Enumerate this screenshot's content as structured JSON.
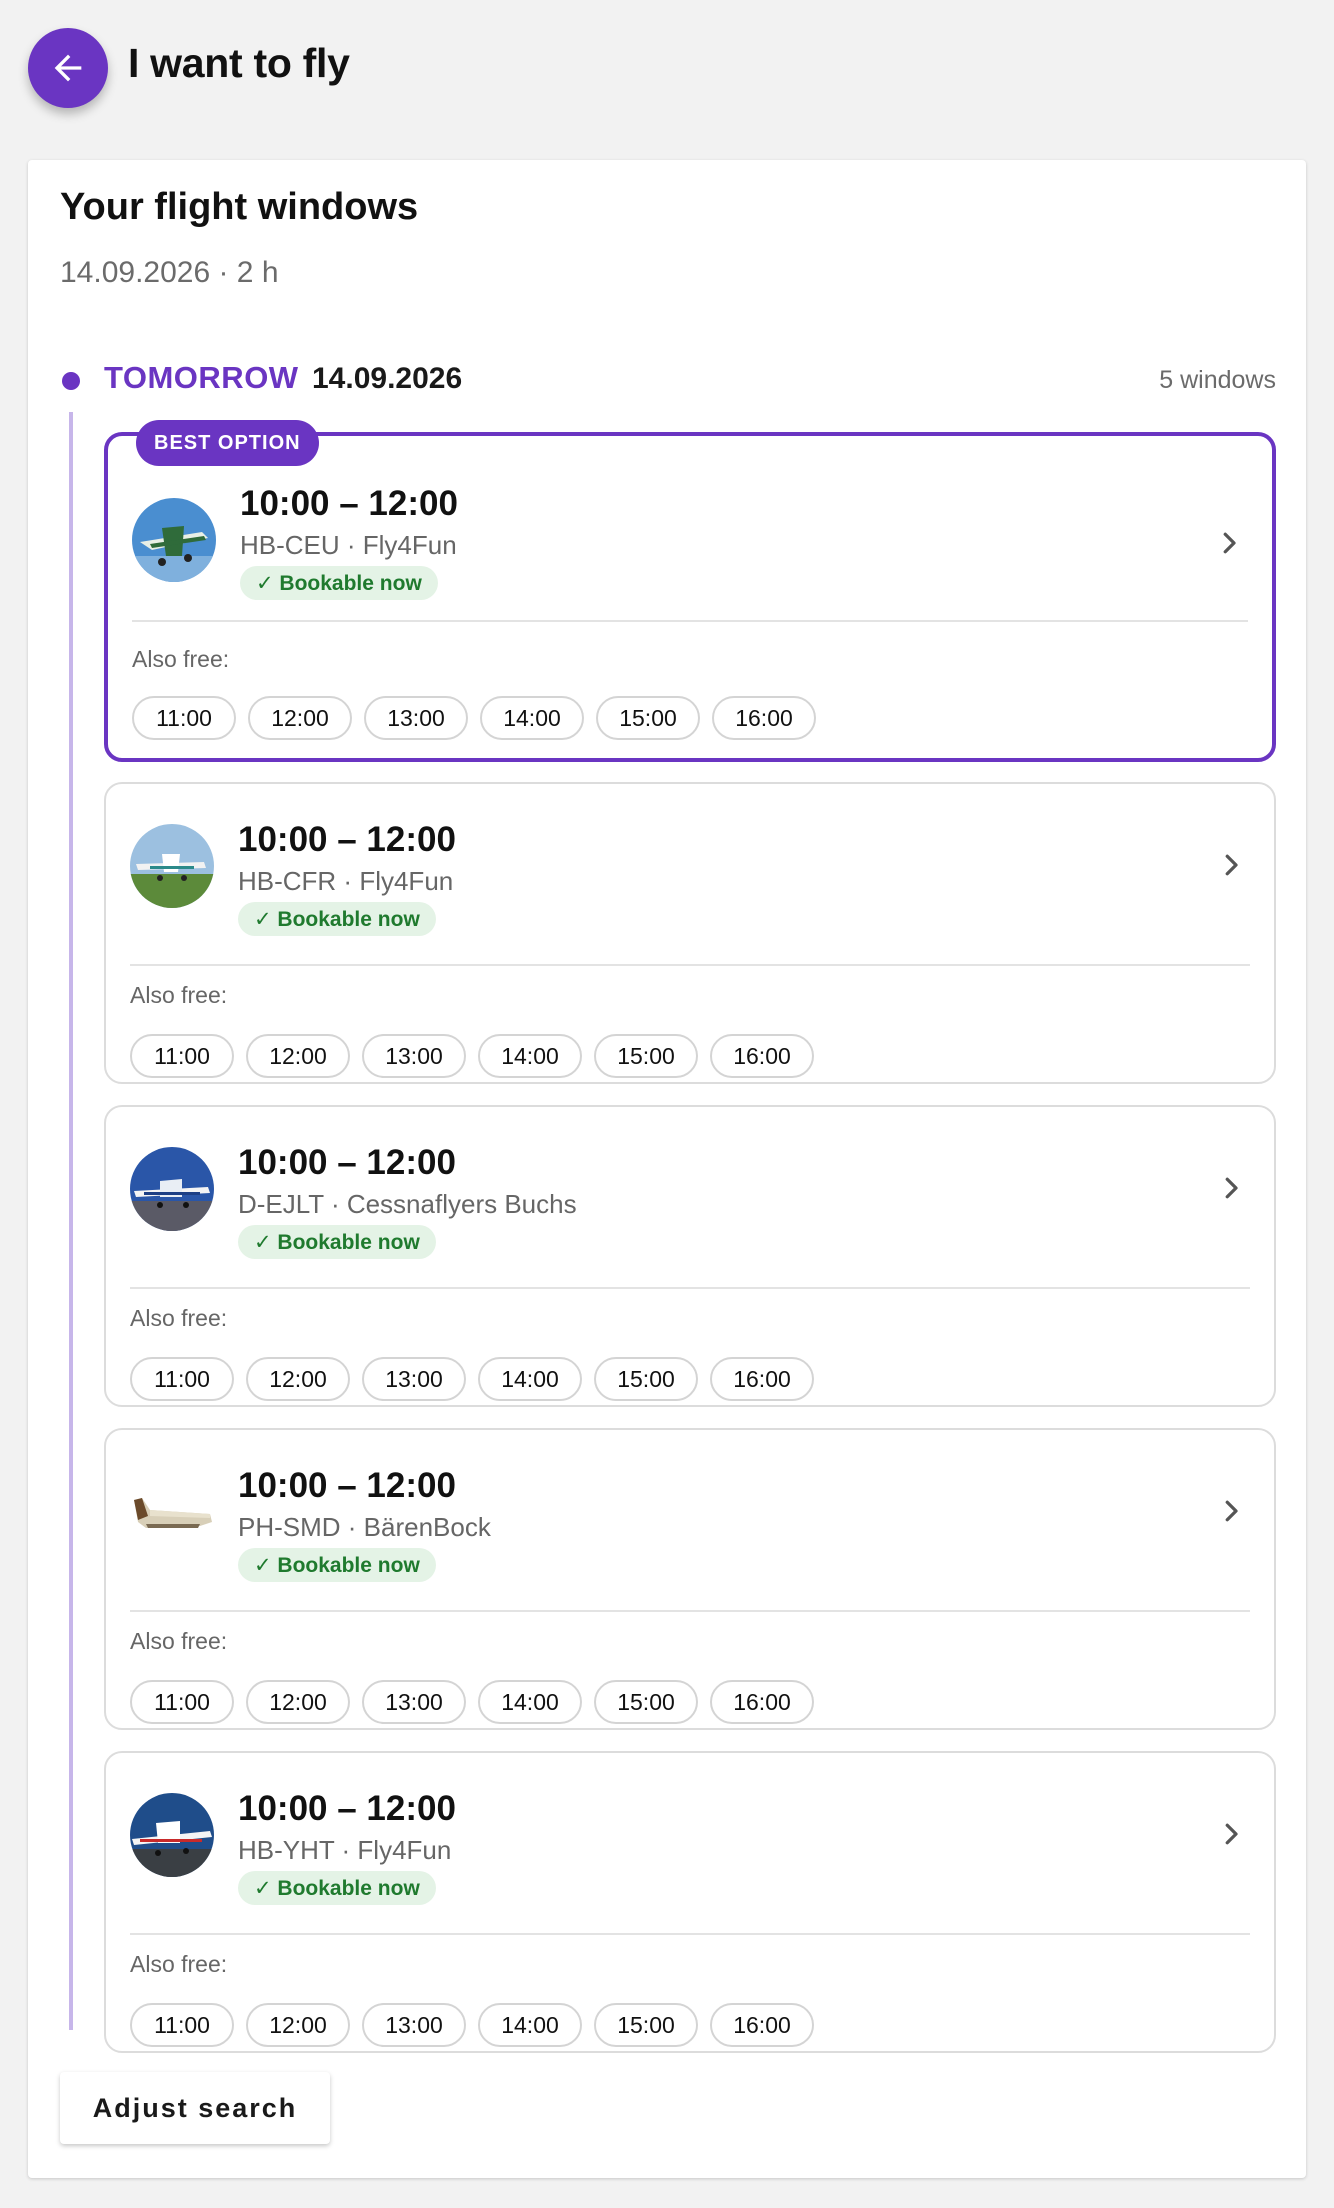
{
  "app_bar": {
    "back_icon": "arrow-left-icon",
    "title": "I want to fly"
  },
  "colors": {
    "accent": "#6a35c2",
    "timeline": "#c7b6ea",
    "bookable_bg": "#e4f3e6",
    "bookable_text": "#1f7a2e"
  },
  "section": {
    "title": "Your flight windows",
    "subtitle": "14.09.2026 · 2 h"
  },
  "day": {
    "label": "TOMORROW",
    "date": "14.09.2026",
    "count": "5 windows"
  },
  "best_badge": "BEST OPTION",
  "windows": [
    {
      "time": "10:00 – 12:00",
      "aircraft": "HB-CEU · Fly4Fun",
      "status": "✓ Bookable now",
      "also_free_label": "Also free:",
      "slots": [
        "11:00",
        "12:00",
        "13:00",
        "14:00",
        "15:00",
        "16:00"
      ]
    },
    {
      "time": "10:00 – 12:00",
      "aircraft": "HB-CFR · Fly4Fun",
      "status": "✓ Bookable now",
      "also_free_label": "Also free:",
      "slots": [
        "11:00",
        "12:00",
        "13:00",
        "14:00",
        "15:00",
        "16:00"
      ]
    },
    {
      "time": "10:00 – 12:00",
      "aircraft": "D-EJLT · Cessnaflyers Buchs",
      "status": "✓ Bookable now",
      "also_free_label": "Also free:",
      "slots": [
        "11:00",
        "12:00",
        "13:00",
        "14:00",
        "15:00",
        "16:00"
      ]
    },
    {
      "time": "10:00 – 12:00",
      "aircraft": "PH-SMD · BärenBock",
      "status": "✓ Bookable now",
      "also_free_label": "Also free:",
      "slots": [
        "11:00",
        "12:00",
        "13:00",
        "14:00",
        "15:00",
        "16:00"
      ]
    },
    {
      "time": "10:00 – 12:00",
      "aircraft": "HB-YHT · Fly4Fun",
      "status": "✓ Bookable now",
      "also_free_label": "Also free:",
      "slots": [
        "11:00",
        "12:00",
        "13:00",
        "14:00",
        "15:00",
        "16:00"
      ]
    }
  ],
  "adjust_button": "Adjust search"
}
